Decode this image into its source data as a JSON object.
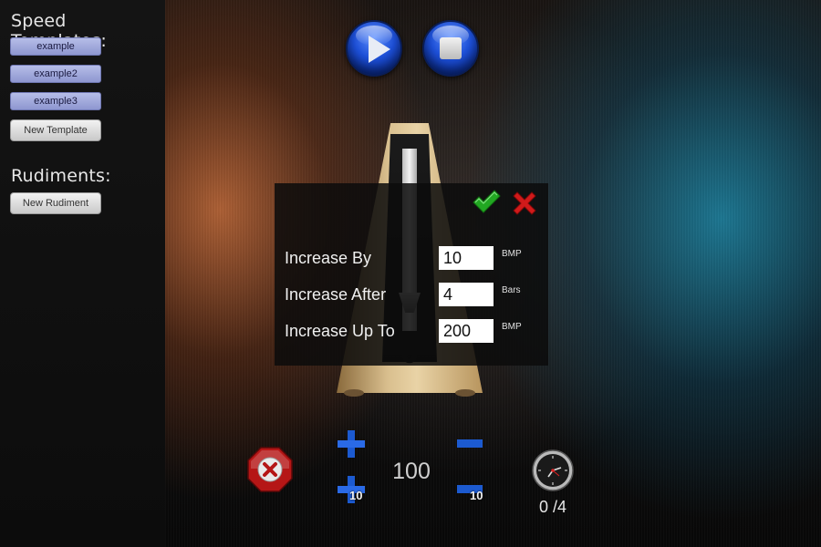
{
  "sidebar": {
    "speed_templates_title": "Speed Templates:",
    "templates": [
      {
        "label": "example"
      },
      {
        "label": "example2"
      },
      {
        "label": "example3"
      }
    ],
    "new_template_label": "New Template",
    "rudiments_title": "Rudiments:",
    "new_rudiment_label": "New Rudiment"
  },
  "transport": {
    "play_icon": "play-icon",
    "stop_icon": "stop-icon"
  },
  "metronome": {
    "beat_number": "0"
  },
  "dialog": {
    "confirm_icon": "check-icon",
    "cancel_icon": "close-icon",
    "fields": [
      {
        "label": "Increase By",
        "value": "10",
        "unit": "BMP"
      },
      {
        "label": "Increase After",
        "value": "4",
        "unit": "Bars"
      },
      {
        "label": "Increase Up To",
        "value": "200",
        "unit": "BMP"
      }
    ]
  },
  "controls": {
    "tempo": "100",
    "plus_step": "10",
    "minus_step": "10",
    "bar_count": "0 /4"
  },
  "colors": {
    "template_button": "#9aa2d8",
    "confirm_green": "#22a822",
    "cancel_red": "#d11a1a",
    "orb_blue": "#1d4fd6"
  }
}
